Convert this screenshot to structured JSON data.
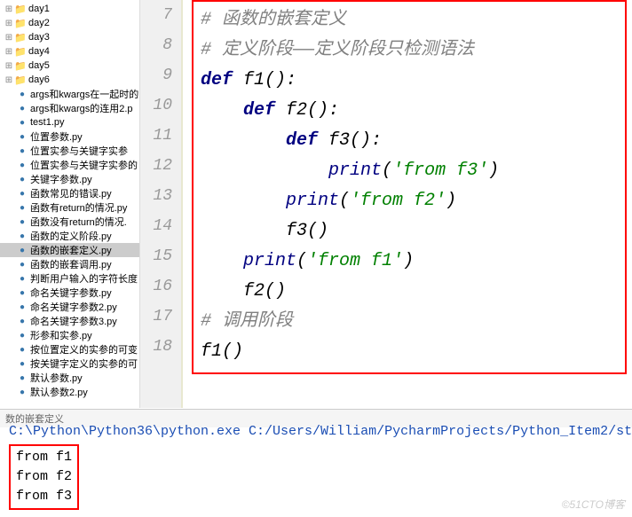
{
  "sidebar": {
    "folders": [
      "day1",
      "day2",
      "day3",
      "day4",
      "day5",
      "day6"
    ],
    "files": [
      "args和kwargs在一起时的",
      "args和kwargs的连用2.p",
      "test1.py",
      "位置参数.py",
      "位置实参与关键字实参",
      "位置实参与关键字实参的",
      "关键字参数.py",
      "函数常见的错误.py",
      "函数有return的情况.py",
      "函数没有return的情况.",
      "函数的定义阶段.py",
      "函数的嵌套定义.py",
      "函数的嵌套调用.py",
      "判断用户输入的字符长度",
      "命名关键字参数.py",
      "命名关键字参数2.py",
      "命名关键字参数3.py",
      "形参和实参.py",
      "按位置定义的实参的可变",
      "按关键字定义的实参的可",
      "默认参数.py",
      "默认参数2.py"
    ],
    "selected_index": 11
  },
  "gutter": {
    "start": 7,
    "end": 18
  },
  "code": {
    "l7": {
      "comment": "# 函数的嵌套定义"
    },
    "l8": {
      "comment": "# 定义阶段——定义阶段只检测语法"
    },
    "l9": {
      "kw": "def",
      "name": " f1",
      "paren": "():"
    },
    "l10": {
      "indent": "    ",
      "kw": "def",
      "name": " f2",
      "paren": "():"
    },
    "l11": {
      "indent": "        ",
      "kw": "def",
      "name": " f3",
      "paren": "():"
    },
    "l12": {
      "indent": "            ",
      "call": "print",
      "open": "(",
      "str": "'from f3'",
      "close": ")"
    },
    "l13": {
      "indent": "        ",
      "call": "print",
      "open": "(",
      "str": "'from f2'",
      "close": ")"
    },
    "l14": {
      "indent": "        ",
      "text": "f3()"
    },
    "l15": {
      "indent": "    ",
      "call": "print",
      "open": "(",
      "str": "'from f1'",
      "close": ")"
    },
    "l16": {
      "indent": "    ",
      "text": "f2()"
    },
    "l17": {
      "comment": "# 调用阶段"
    },
    "l18": {
      "text": "f1()"
    }
  },
  "console": {
    "tab": "数的嵌套定义",
    "cmd": "C:\\Python\\Python36\\python.exe C:/Users/William/PycharmProjects/Python_Item2/st",
    "out": [
      "from f1",
      "from f2",
      "from f3"
    ]
  },
  "watermark": "©51CTO博客"
}
